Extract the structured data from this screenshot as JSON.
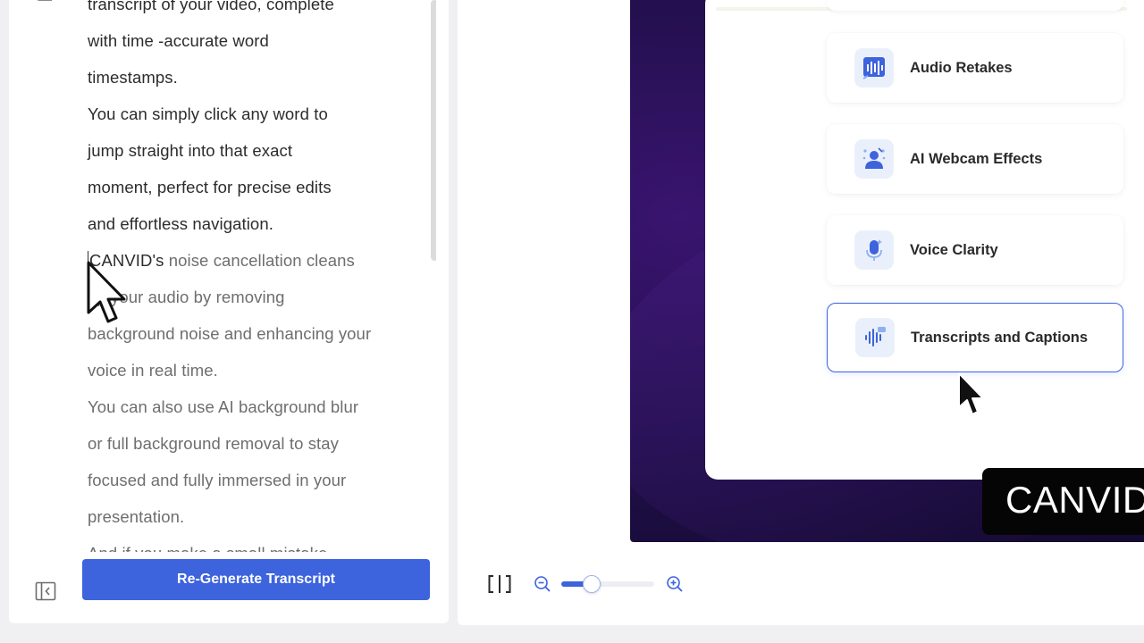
{
  "transcript": {
    "lines": [
      {
        "text": "transcript of your video, complete",
        "tone": "dark"
      },
      {
        "text": "with time -accurate word",
        "tone": "dark"
      },
      {
        "text": "timestamps.",
        "tone": "dark"
      },
      {
        "text": "You can simply click any word to",
        "tone": "dark"
      },
      {
        "text": "jump straight into that exact",
        "tone": "dark"
      },
      {
        "text": "moment, perfect for precise edits",
        "tone": "dark"
      },
      {
        "text": "and effortless navigation.",
        "tone": "dark"
      }
    ],
    "highlight_word": "CANVID's",
    "highlight_rest": " noise cancellation cleans",
    "lines_after": [
      {
        "text": "up your audio by removing",
        "tone": "gray"
      },
      {
        "text": "background noise and enhancing your",
        "tone": "gray"
      },
      {
        "text": "voice in real time.",
        "tone": "gray"
      },
      {
        "text": "You can also use AI background blur",
        "tone": "gray"
      },
      {
        "text": "or full background removal to stay",
        "tone": "gray"
      },
      {
        "text": "focused and fully immersed in your",
        "tone": "gray"
      },
      {
        "text": "presentation.",
        "tone": "gray"
      },
      {
        "text": "And if you make a small mistake,",
        "tone": "gray"
      }
    ]
  },
  "regenerate_button": "Re-Generate Transcript",
  "features": [
    {
      "label": "Audio Retakes",
      "icon": "audio-retakes-icon"
    },
    {
      "label": "AI Webcam Effects",
      "icon": "webcam-effects-icon"
    },
    {
      "label": "Voice Clarity",
      "icon": "microphone-icon"
    },
    {
      "label": "Transcripts and Captions",
      "icon": "captions-icon",
      "active": true
    }
  ],
  "caption_text": "CANVID",
  "zoom": {
    "level": 0.28
  },
  "colors": {
    "accent": "#3d63dd",
    "video_bg": "#1c0d42",
    "caption_bg": "#050505"
  }
}
